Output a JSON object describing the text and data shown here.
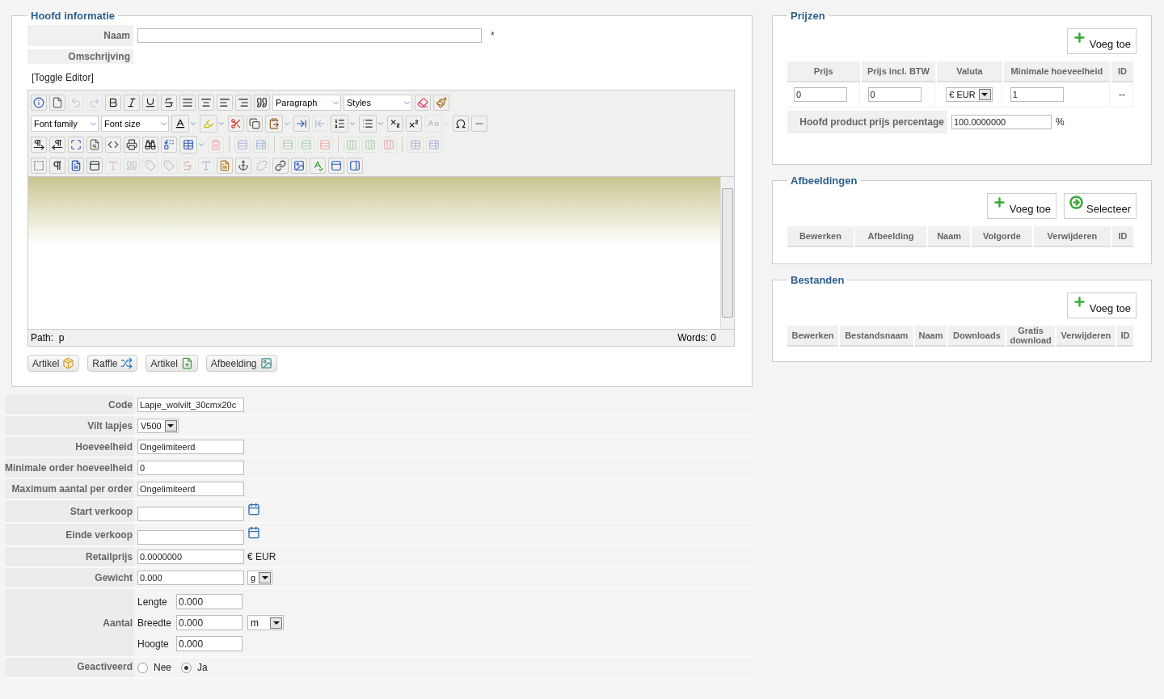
{
  "main_info": {
    "title": "Hoofd informatie",
    "name_field": {
      "label": "Naam",
      "required_mark": "*"
    },
    "description_label": "Omschrijving",
    "toggle_editor": "[Toggle Editor]",
    "editor": {
      "toolbar": [
        {
          "items": [
            {
              "kind": "button",
              "disabled": false
            },
            {
              "kind": "button",
              "disabled": false
            },
            {
              "kind": "button",
              "disabled": true
            },
            {
              "kind": "button",
              "disabled": true
            },
            {
              "kind": "button",
              "disabled": false
            },
            {
              "kind": "button",
              "disabled": false
            },
            {
              "kind": "button",
              "disabled": false
            },
            {
              "kind": "button",
              "disabled": false
            },
            {
              "kind": "button",
              "disabled": false
            },
            {
              "kind": "button",
              "disabled": false
            },
            {
              "kind": "button",
              "disabled": false
            },
            {
              "kind": "button",
              "disabled": false
            },
            {
              "kind": "button",
              "disabled": false
            },
            {
              "kind": "select",
              "label": "Paragraph"
            },
            {
              "kind": "select",
              "label": "Styles"
            },
            {
              "kind": "button",
              "disabled": false
            },
            {
              "kind": "button",
              "disabled": false
            }
          ]
        },
        {
          "items": [
            {
              "kind": "select",
              "label": "Font family"
            },
            {
              "kind": "select",
              "label": "Font size"
            },
            {
              "kind": "split",
              "disabled": false
            },
            {
              "kind": "split",
              "disabled": false
            },
            {
              "kind": "button",
              "disabled": false
            },
            {
              "kind": "button",
              "disabled": false
            },
            {
              "kind": "split",
              "disabled": false
            },
            {
              "kind": "button",
              "disabled": false
            },
            {
              "kind": "button",
              "disabled": true
            },
            {
              "kind": "split",
              "disabled": false
            },
            {
              "kind": "split",
              "disabled": false
            },
            {
              "kind": "button",
              "disabled": false
            },
            {
              "kind": "button",
              "disabled": false
            },
            {
              "kind": "split",
              "disabled": true
            },
            {
              "kind": "button",
              "disabled": false
            },
            {
              "kind": "button",
              "disabled": false
            }
          ]
        },
        {
          "items": [
            {
              "kind": "button",
              "disabled": false
            },
            {
              "kind": "button",
              "disabled": false
            },
            {
              "kind": "button",
              "disabled": false
            },
            {
              "kind": "button",
              "disabled": false
            },
            {
              "kind": "button",
              "disabled": false
            },
            {
              "kind": "button",
              "disabled": false
            },
            {
              "kind": "button",
              "disabled": false
            },
            {
              "kind": "button",
              "disabled": false
            },
            {
              "kind": "split",
              "disabled": false
            },
            {
              "kind": "button",
              "disabled": true
            },
            {
              "kind": "separator"
            },
            {
              "kind": "button",
              "disabled": true
            },
            {
              "kind": "button",
              "disabled": true
            },
            {
              "kind": "separator"
            },
            {
              "kind": "button",
              "disabled": true
            },
            {
              "kind": "button",
              "disabled": true
            },
            {
              "kind": "button",
              "disabled": true
            },
            {
              "kind": "separator"
            },
            {
              "kind": "button",
              "disabled": true
            },
            {
              "kind": "button",
              "disabled": true
            },
            {
              "kind": "button",
              "disabled": true
            },
            {
              "kind": "separator"
            },
            {
              "kind": "button",
              "disabled": true
            },
            {
              "kind": "button",
              "disabled": true
            }
          ]
        },
        {
          "items": [
            {
              "kind": "button",
              "disabled": false
            },
            {
              "kind": "button",
              "disabled": false
            },
            {
              "kind": "button",
              "disabled": false
            },
            {
              "kind": "button",
              "disabled": false
            },
            {
              "kind": "button",
              "disabled": true
            },
            {
              "kind": "button",
              "disabled": true
            },
            {
              "kind": "button",
              "disabled": true
            },
            {
              "kind": "button",
              "disabled": true
            },
            {
              "kind": "button",
              "disabled": true
            },
            {
              "kind": "button",
              "disabled": true
            },
            {
              "kind": "button",
              "disabled": false
            },
            {
              "kind": "button",
              "disabled": false
            },
            {
              "kind": "button",
              "disabled": true
            },
            {
              "kind": "button",
              "disabled": false
            },
            {
              "kind": "button",
              "disabled": false
            },
            {
              "kind": "button",
              "disabled": false
            },
            {
              "kind": "button",
              "disabled": false
            },
            {
              "kind": "button",
              "disabled": false
            }
          ]
        }
      ],
      "path_label": "Path:",
      "path": "p",
      "word_count": "Words: 0"
    },
    "insert_buttons": [
      {
        "label": "Artikel",
        "kind": "box"
      },
      {
        "label": "Raffle",
        "kind": "shuffle"
      },
      {
        "label": "Artikel",
        "kind": "add-file"
      },
      {
        "label": "Afbeelding",
        "kind": "image"
      }
    ]
  },
  "details": [
    {
      "kind": "text",
      "label": "Code",
      "value": "Lapje_wolvilt_30cmx20c"
    },
    {
      "kind": "select",
      "label": "Vilt lapjes",
      "value": "V500"
    },
    {
      "kind": "text",
      "label": "Hoeveelheid",
      "value": "Ongelimiteerd"
    },
    {
      "kind": "text",
      "label": "Minimale order hoeveelheid",
      "value": "0"
    },
    {
      "kind": "text",
      "label": "Maximum aantal per order",
      "value": "Ongelimiteerd"
    },
    {
      "kind": "date",
      "label": "Start verkoop"
    },
    {
      "kind": "date",
      "label": "Einde verkoop"
    },
    {
      "kind": "text",
      "label": "Retailprijs",
      "value": "0.0000000",
      "suffix": "€ EUR"
    },
    {
      "kind": "unit",
      "label": "Gewicht",
      "value": "0.000",
      "unit": "g"
    },
    {
      "kind": "dimensions",
      "label": "Aantal",
      "unit": "m",
      "parts": [
        {
          "label": "Lengte",
          "value": "0.000"
        },
        {
          "label": "Breedte",
          "value": "0.000"
        },
        {
          "label": "Hoogte",
          "value": "0.000"
        }
      ]
    },
    {
      "kind": "radio",
      "label": "Geactiveerd",
      "options": [
        {
          "label": "Nee",
          "selected": false
        },
        {
          "label": "Ja",
          "selected": true
        }
      ]
    }
  ],
  "prices": {
    "title": "Prijzen",
    "buttons": [
      {
        "label": "Voeg toe",
        "kind": "add"
      }
    ],
    "columns": [
      "Prijs",
      "Prijs incl. BTW",
      "Valuta",
      "Minimale hoeveelheid",
      "ID"
    ],
    "rows": [
      {
        "cells": [
          {
            "kind": "input",
            "value": "0"
          },
          {
            "kind": "input",
            "value": "0"
          },
          {
            "kind": "select",
            "value": "€ EUR"
          },
          {
            "kind": "input",
            "value": "1"
          },
          {
            "kind": "text",
            "value": "--"
          }
        ]
      }
    ],
    "percentage": {
      "label": "Hoofd product prijs percentage",
      "value": "100.0000000",
      "suffix": "%"
    }
  },
  "images": {
    "title": "Afbeeldingen",
    "buttons": [
      {
        "label": "Voeg toe",
        "kind": "add"
      },
      {
        "label": "Selecteer",
        "kind": "select"
      }
    ],
    "columns": [
      "Bewerken",
      "Afbeelding",
      "Naam",
      "Volgorde",
      "Verwijderen",
      "ID"
    ]
  },
  "files": {
    "title": "Bestanden",
    "buttons": [
      {
        "label": "Voeg toe",
        "kind": "add"
      }
    ],
    "columns": [
      "Bewerken",
      "Bestandsnaam",
      "Naam",
      "Downloads",
      "Gratis download",
      "Verwijderen",
      "ID"
    ]
  }
}
